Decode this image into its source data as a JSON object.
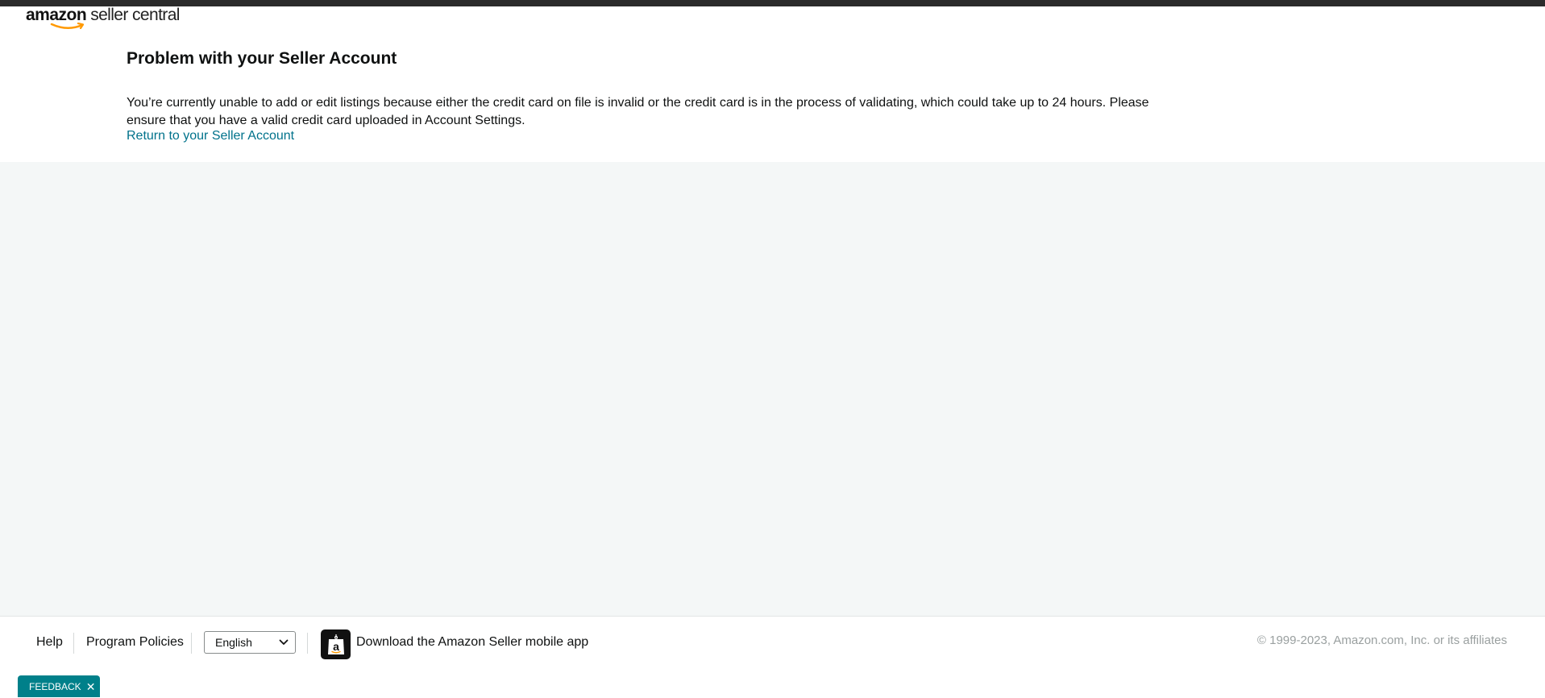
{
  "header": {
    "logo_brand": "amazon",
    "logo_sub": "seller central"
  },
  "main": {
    "title": "Problem with your Seller Account",
    "message": "You’re currently unable to add or edit listings because either the credit card on file is invalid or the credit card is in the process of validating, which could take up to 24 hours. Please ensure that you have a valid credit card uploaded in Account Settings.",
    "return_link": "Return to your Seller Account"
  },
  "footer": {
    "help_label": "Help",
    "policies_label": "Program Policies",
    "language_selected": "English",
    "app_icon": "amazon-a-shopping-bag-icon",
    "app_label": "Download the Amazon Seller mobile app",
    "copyright": "© 1999-2023, Amazon.com, Inc. or its affiliates"
  },
  "feedback": {
    "label": "FEEDBACK",
    "close_icon": "close-icon"
  },
  "colors": {
    "link": "#00728b",
    "feedback_bg": "#00808a",
    "page_gray": "#f4f7f7",
    "brand_orange": "#ff9900"
  }
}
